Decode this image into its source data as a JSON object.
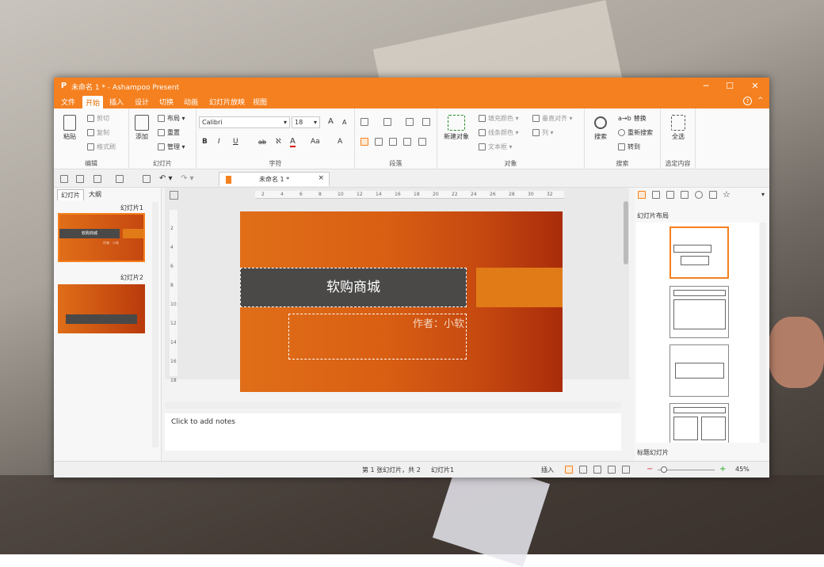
{
  "window": {
    "title": "未命名 1 * - Ashampoo Present",
    "logo": "P",
    "controls": [
      "─",
      "☐",
      "✕"
    ]
  },
  "menu": {
    "tabs": [
      "文件",
      "开始",
      "插入",
      "设计",
      "切换",
      "动画",
      "幻灯片放映",
      "视图"
    ],
    "active": "开始",
    "help": "?",
    "collapse": "^"
  },
  "ribbon": {
    "edit": {
      "label": "编辑",
      "paste": "粘贴",
      "cut": "剪切",
      "copy": "复制",
      "format_painter": "格式刷"
    },
    "slides": {
      "label": "幻灯片",
      "add": "添加",
      "layout": "布局",
      "reset": "重置",
      "manage": "管理"
    },
    "font": {
      "label": "字符",
      "font_name": "Calibri",
      "font_size": "18",
      "bold": "B",
      "italic": "I",
      "underline": "U",
      "strike": "ab",
      "grow": "A",
      "shrink": "A"
    },
    "paragraph": {
      "label": "段落"
    },
    "objects": {
      "label": "对象",
      "new_object": "新建对象",
      "fill_color": "填充颜色",
      "line_color": "线条颜色",
      "text_frame": "文本框",
      "valign": "垂直对齐",
      "columns": "列"
    },
    "search": {
      "label": "搜索",
      "search": "搜索",
      "replace": "替换",
      "search_again": "重新搜索",
      "goto": "转到"
    },
    "select": {
      "label": "选定内容",
      "select_all": "全选"
    }
  },
  "doc_tab": {
    "title": "未命名 1 *",
    "close": "×"
  },
  "ruler_ticks": [
    "2",
    "4",
    "6",
    "8",
    "10",
    "12",
    "14",
    "16",
    "18",
    "20",
    "22",
    "24",
    "26",
    "28",
    "30",
    "32"
  ],
  "vruler_ticks": [
    "2",
    "4",
    "6",
    "8",
    "10",
    "12",
    "14",
    "16",
    "18"
  ],
  "left_pane": {
    "tabs": [
      "幻灯片",
      "大纲"
    ],
    "slides": [
      {
        "label": "幻灯片1",
        "title": "软购商城",
        "sub": "作者：小软"
      },
      {
        "label": "幻灯片2"
      }
    ]
  },
  "slide": {
    "title": "软购商城",
    "subtitle": "作者：小软"
  },
  "notes": {
    "placeholder": "Click to add notes"
  },
  "right_pane": {
    "section": "幻灯片布局",
    "footer": "标题幻灯片"
  },
  "status": {
    "slide_info": "第 1 张幻灯片，共 2",
    "slide_name": "幻灯片1",
    "mode": "插入",
    "zoom": "45%",
    "minus": "−",
    "plus": "+"
  },
  "colors": {
    "accent": "#f5801f",
    "slide_dark": "#4a4948"
  }
}
